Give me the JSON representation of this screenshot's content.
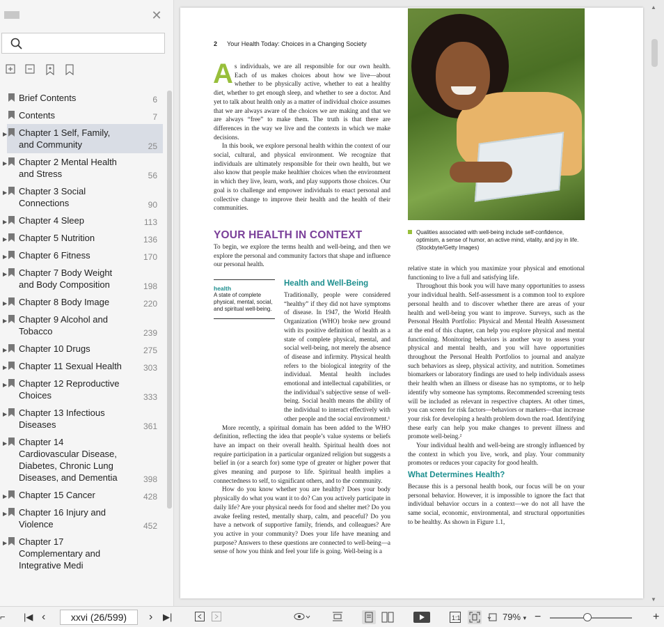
{
  "sidebar": {
    "items": [
      {
        "title": "Brief Contents",
        "page": "6",
        "expandable": false
      },
      {
        "title": "Contents",
        "page": "7",
        "expandable": false
      },
      {
        "title": "Chapter 1 Self, Family, and Community",
        "page": "25",
        "expandable": true,
        "selected": true
      },
      {
        "title": "Chapter 2 Mental Health and Stress",
        "page": "56",
        "expandable": true
      },
      {
        "title": "Chapter 3 Social Connections",
        "page": "90",
        "expandable": true
      },
      {
        "title": "Chapter 4 Sleep",
        "page": "113",
        "expandable": true
      },
      {
        "title": "Chapter 5 Nutrition",
        "page": "136",
        "expandable": true
      },
      {
        "title": "Chapter 6 Fitness",
        "page": "170",
        "expandable": true
      },
      {
        "title": "Chapter 7 Body Weight and Body Composition",
        "page": "198",
        "expandable": true
      },
      {
        "title": "Chapter 8 Body Image",
        "page": "220",
        "expandable": true
      },
      {
        "title": "Chapter 9 Alcohol and Tobacco",
        "page": "239",
        "expandable": true
      },
      {
        "title": "Chapter 10 Drugs",
        "page": "275",
        "expandable": true
      },
      {
        "title": "Chapter 11 Sexual Health",
        "page": "303",
        "expandable": true
      },
      {
        "title": "Chapter 12 Reproductive Choices",
        "page": "333",
        "expandable": true
      },
      {
        "title": "Chapter 13 Infectious Diseases",
        "page": "361",
        "expandable": true
      },
      {
        "title": "Chapter 14 Cardiovascular Disease, Diabetes, Chronic Lung Diseases, and Dementia",
        "page": "398",
        "expandable": true
      },
      {
        "title": "Chapter 15 Cancer",
        "page": "428",
        "expandable": true
      },
      {
        "title": "Chapter 16 Injury and Violence",
        "page": "452",
        "expandable": true
      },
      {
        "title": "Chapter 17 Complementary and Integrative Medi",
        "page": "",
        "expandable": true
      }
    ]
  },
  "page": {
    "number": "2",
    "running_head": "Your Health Today: Choices in a Changing Society",
    "dropcap": "A",
    "intro_p1": "s individuals, we are all responsible for our own health. Each of us makes choices about how we live—about whether to be physically active, whether to eat a healthy diet, whether to get enough sleep, and whether to see a doctor. And yet to talk about health only as a matter of individual choice assumes that we are always aware of the choices we are making and that we are always “free” to make them. The truth is that there are differences in the way we live and the contexts in which we make decisions.",
    "intro_p2": "In this book, we explore personal health within the context of our social, cultural, and physical environment. We recognize that individuals are ultimately responsible for their own health, but we also know that people make healthier choices when the environment in which they live, learn, work, and play supports those choices. Our goal is to challenge and empower individuals to enact personal and collective change to improve their health and the health of their communities.",
    "section_title": "YOUR HEALTH IN CONTEXT",
    "section_intro": "To begin, we explore the terms health and well-being, and then we explore the personal and community factors that shape and influence our personal health.",
    "sidebar_term": "health",
    "sidebar_def": "A state of complete physical, mental, social, and spiritual well-being.",
    "subhead1": "Health and Well-Being",
    "hw_p1": "Traditionally, people were considered “healthy” if they did not have symptoms of disease. In 1947, the World Health Organization (WHO) broke new ground with its positive definition of health as a state of complete physical, mental, and social well-being, not merely the absence of disease and infirmity. Physical health refers to the biological integrity of the individual. Mental health includes emotional and intellectual capabilities, or the individual’s subjective sense of well-being. Social health means the ability of the individual to interact effectively with other people and the social environment.¹",
    "hw_p2": "More recently, a spiritual domain has been added to the WHO definition, reflecting the idea that people’s value systems or beliefs have an impact on their overall health. Spiritual health does not require participation in a particular organized religion but suggests a belief in (or a search for) some type of greater or higher power that gives meaning and purpose to life. Spiritual health implies a connectedness to self, to significant others, and to the community.",
    "hw_p3": "How do you know whether you are healthy? Does your body physically do what you want it to do? Can you actively participate in daily life? Are your physical needs for food and shelter met? Do you awake feeling rested, mentally sharp, calm, and peaceful? Do you have a network of supportive family, friends, and colleagues? Are you active in your community? Does your life have meaning and purpose? Answers to these questions are connected to well-being—a sense of how you think and feel your life is going. Well-being is a",
    "caption": "Qualities associated with well-being include self-confidence, optimism, a sense of humor, an active mind, vitality, and joy in life. (Stockbyte/Getty Images)",
    "right_p1": "relative state in which you maximize your physical and emotional functioning to live a full and satisfying life.",
    "right_p2": "Throughout this book you will have many opportunities to assess your individual health. Self-assessment is a common tool to explore personal health and to discover whether there are areas of your health and well-being you want to improve. Surveys, such as the Personal Health Portfolio: Physical and Mental Health Assessment at the end of this chapter, can help you explore physical and mental functioning. Monitoring behaviors is another way to assess your physical and mental health, and you will have opportunities throughout the Personal Health Portfolios to journal and analyze such behaviors as sleep, physical activity, and nutrition. Sometimes biomarkers or laboratory findings are used to help individuals assess their health when an illness or disease has no symptoms, or to help identify why someone has symptoms. Recommended screening tests will be included as relevant in respective chapters. At other times, you can screen for risk factors—behaviors or markers—that increase your risk for developing a health problem down the road. Identifying these early can help you make changes to prevent illness and promote well-being.²",
    "right_p3": "Your individual health and well-being are strongly influenced by the context in which you live, work, and play. Your community promotes or reduces your capacity for good health.",
    "subhead2": "What Determines Health?",
    "right_p4": "Because this is a personal health book, our focus will be on your personal behavior. However, it is impossible to ignore the fact that individual behavior occurs in a context—we do not all have the same social, economic, environmental, and structural opportunities to be healthy. As shown in Figure 1.1,"
  },
  "statusbar": {
    "page_indicator": "xxvi (26/599)",
    "zoom": "79%"
  }
}
